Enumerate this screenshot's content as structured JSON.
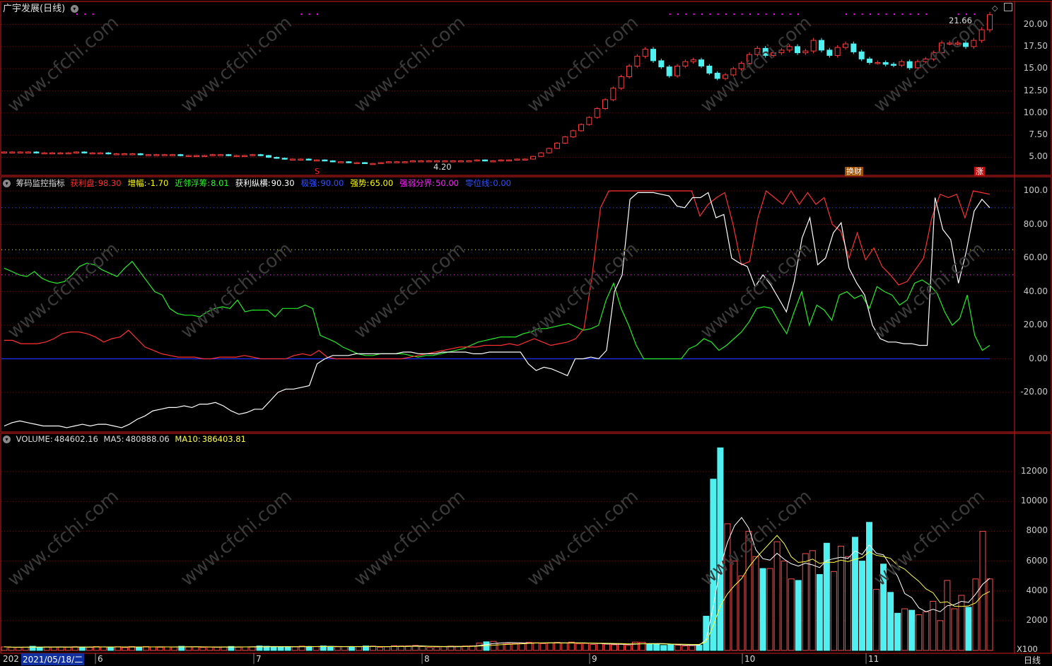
{
  "title": "广宇发展(日线)",
  "price": {
    "yticks": [
      "20.00",
      "17.50",
      "15.00",
      "12.50",
      "10.00",
      "7.50",
      "5.00"
    ],
    "high_label": "21.66",
    "low_label": "4.20",
    "markers": {
      "s": "S",
      "b1": "换财",
      "b2": "涨"
    }
  },
  "indicator": {
    "name": "筹码监控指标",
    "items": [
      {
        "label": "获利盘:",
        "value": "98.30",
        "color": "#ff3030"
      },
      {
        "label": "增幅:",
        "value": "-1.70",
        "color": "#ffff00"
      },
      {
        "label": "近邻浮筹:",
        "value": "8.01",
        "color": "#22ff22"
      },
      {
        "label": "获利纵横:",
        "value": "90.30",
        "color": "#ffffff"
      },
      {
        "label": "极强:",
        "value": "90.00",
        "color": "#3050ff"
      },
      {
        "label": "强势:",
        "value": "65.00",
        "color": "#ffff00"
      },
      {
        "label": "强弱分界:",
        "value": "50.00",
        "color": "#ff20ff"
      },
      {
        "label": "零位线:",
        "value": "0.00",
        "color": "#3050ff"
      }
    ],
    "yticks": [
      "100.0",
      "80.00",
      "60.00",
      "40.00",
      "20.00",
      "0.00",
      "-20.00"
    ]
  },
  "volume": {
    "name": "VOLUME:",
    "value": "484602.16",
    "ma5_label": "MA5:",
    "ma5": "480888.06",
    "ma10_label": "MA10:",
    "ma10": "386403.81",
    "yticks": [
      "12000",
      "10000",
      "8000",
      "6000",
      "4000",
      "2000"
    ],
    "unit": "X100"
  },
  "xaxis": {
    "start_trunc": "202",
    "date_label": "2021/05/18/二",
    "months": [
      "6",
      "7",
      "8",
      "9",
      "10",
      "11"
    ],
    "period": "日线"
  },
  "watermark": "www.cfchi.com",
  "chart_data": {
    "type": "line",
    "panels": [
      "candlestick price",
      "筹码监控指标",
      "VOLUME"
    ],
    "price_close": [
      5.6,
      5.6,
      5.6,
      5.6,
      5.5,
      5.5,
      5.5,
      5.5,
      5.5,
      5.6,
      5.5,
      5.5,
      5.5,
      5.4,
      5.4,
      5.4,
      5.4,
      5.3,
      5.3,
      5.3,
      5.3,
      5.3,
      5.2,
      5.2,
      5.2,
      5.2,
      5.3,
      5.3,
      5.2,
      5.2,
      5.2,
      5.3,
      5.2,
      5.0,
      4.9,
      4.8,
      4.8,
      4.8,
      4.7,
      4.7,
      4.6,
      4.5,
      4.5,
      4.4,
      4.4,
      4.3,
      4.3,
      4.4,
      4.5,
      4.5,
      4.5,
      4.6,
      4.6,
      4.6,
      4.6,
      4.6,
      4.6,
      4.6,
      4.6,
      4.7,
      4.6,
      4.6,
      4.7,
      4.7,
      4.8,
      4.8,
      5.1,
      5.5,
      6.0,
      6.6,
      7.3,
      8.0,
      8.7,
      9.5,
      10.5,
      11.5,
      12.8,
      14.1,
      15.3,
      16.4,
      17.2,
      15.9,
      15.2,
      14.2,
      15.3,
      15.8,
      16.0,
      15.3,
      14.5,
      13.9,
      14.3,
      15.0,
      15.6,
      16.6,
      17.3,
      16.5,
      16.8,
      17.1,
      17.5,
      16.8,
      17.0,
      18.2,
      17.1,
      16.5,
      17.4,
      17.8,
      16.9,
      16.1,
      15.7,
      15.7,
      15.5,
      15.4,
      15.8,
      15.1,
      15.8,
      16.1,
      16.8,
      17.9,
      17.9,
      17.9,
      17.5,
      18.2,
      19.4,
      21.1
    ],
    "profit_ratio": [
      11,
      11,
      9,
      9,
      9,
      10,
      12,
      15,
      16,
      16,
      15,
      13,
      10,
      12,
      13,
      17,
      12,
      7,
      5,
      3,
      2,
      1,
      1,
      1,
      0,
      0,
      1,
      1,
      1,
      2,
      1,
      0,
      0,
      0,
      0,
      2,
      3,
      2,
      5,
      1,
      0,
      0,
      0,
      0,
      0,
      0,
      0,
      0,
      0,
      1,
      2,
      3,
      4,
      5,
      6,
      7,
      7,
      7,
      8,
      8,
      8,
      9,
      8,
      10,
      12,
      10,
      8,
      9,
      10,
      12,
      18,
      50,
      90,
      100,
      100,
      100,
      100,
      100,
      100,
      100,
      100,
      100,
      100,
      100,
      85,
      92,
      96,
      99,
      80,
      56,
      58,
      84,
      100,
      96,
      92,
      100,
      92,
      99,
      92,
      96,
      80,
      76,
      60,
      75,
      59,
      66,
      55,
      50,
      44,
      46,
      53,
      60,
      84,
      98,
      96,
      98,
      84,
      100,
      99,
      98
    ],
    "chip_profit": [
      -40,
      -38,
      -37,
      -38,
      -39,
      -40,
      -40,
      -40,
      -41,
      -40,
      -39,
      -40,
      -39,
      -39,
      -40,
      -41,
      -39,
      -36,
      -34,
      -31,
      -30,
      -29,
      -29,
      -28,
      -29,
      -27,
      -27,
      -26,
      -28,
      -31,
      -33,
      -32,
      -30,
      -30,
      -25,
      -20,
      -18,
      -18,
      -17,
      -16,
      -3,
      0,
      2,
      2,
      2,
      3,
      3,
      3,
      3,
      3,
      3,
      4,
      4,
      3,
      3,
      3,
      4,
      4,
      4,
      4,
      3,
      3,
      4,
      4,
      4,
      4,
      4,
      -3,
      -7,
      -5,
      -6,
      -8,
      -10,
      0,
      0,
      1,
      0,
      5,
      40,
      50,
      95,
      99,
      99,
      99,
      98,
      97,
      91,
      90,
      96,
      96,
      99,
      84,
      86,
      60,
      57,
      55,
      43,
      50,
      44,
      36,
      28,
      46,
      72,
      84,
      56,
      60,
      75,
      81,
      54,
      45,
      38,
      20,
      12,
      10,
      10,
      9,
      9,
      8,
      8,
      96,
      77,
      71,
      45,
      64,
      88,
      95,
      90
    ],
    "near_chip": [
      54,
      52,
      50,
      49,
      52,
      48,
      46,
      45,
      46,
      50,
      55,
      57,
      56,
      53,
      51,
      49,
      54,
      58,
      52,
      46,
      40,
      38,
      30,
      27,
      26,
      26,
      25,
      28,
      30,
      31,
      30,
      35,
      28,
      29,
      29,
      29,
      25,
      30,
      30,
      30,
      32,
      30,
      14,
      12,
      10,
      7,
      5,
      3,
      2,
      2,
      3,
      3,
      3,
      3,
      2,
      1,
      2,
      2,
      3,
      4,
      5,
      6,
      8,
      10,
      11,
      12,
      13,
      13,
      13,
      15,
      16,
      18,
      18,
      19,
      20,
      21,
      19,
      17,
      18,
      20,
      35,
      45,
      30,
      20,
      8,
      0,
      0,
      0,
      0,
      0,
      0,
      6,
      8,
      12,
      10,
      5,
      8,
      12,
      16,
      22,
      30,
      31,
      30,
      22,
      15,
      28,
      40,
      20,
      32,
      29,
      23,
      38,
      40,
      36,
      38,
      30,
      43,
      40,
      38,
      32,
      35,
      45,
      47,
      44,
      39,
      28,
      20,
      24,
      38,
      14,
      5,
      8
    ],
    "volume": [
      240,
      210,
      200,
      220,
      280,
      200,
      240,
      230,
      230,
      220,
      250,
      230,
      210,
      260,
      240,
      230,
      250,
      190,
      260,
      230,
      260,
      240,
      210,
      240,
      230,
      280,
      250,
      240,
      200,
      220,
      210,
      240,
      270,
      220,
      240,
      250,
      300,
      280,
      260,
      220,
      250,
      240,
      290,
      270,
      250,
      300,
      270,
      240,
      250,
      260,
      250,
      300,
      290,
      210,
      240,
      320,
      300,
      310,
      340,
      260,
      200,
      230,
      250,
      290,
      270,
      300,
      310,
      490,
      580,
      610,
      500,
      460,
      460,
      500,
      550,
      520,
      460,
      510,
      540,
      500,
      560,
      440,
      470,
      400,
      470,
      420,
      380,
      420,
      340,
      560,
      550,
      450,
      420,
      340,
      400,
      350,
      300,
      320,
      350,
      2300,
      11500,
      13600,
      8500,
      6000,
      5000,
      8000,
      6300,
      5500,
      5500,
      7300,
      6000,
      4800,
      4700,
      6500,
      6700,
      5100,
      7200,
      5300,
      7000,
      6300,
      7600,
      6000,
      8600,
      4100,
      5800,
      3900,
      2500,
      2800,
      2700,
      2400,
      2600,
      3300,
      2000,
      4700,
      2800,
      3700,
      2900,
      4800,
      8000,
      4800
    ]
  }
}
